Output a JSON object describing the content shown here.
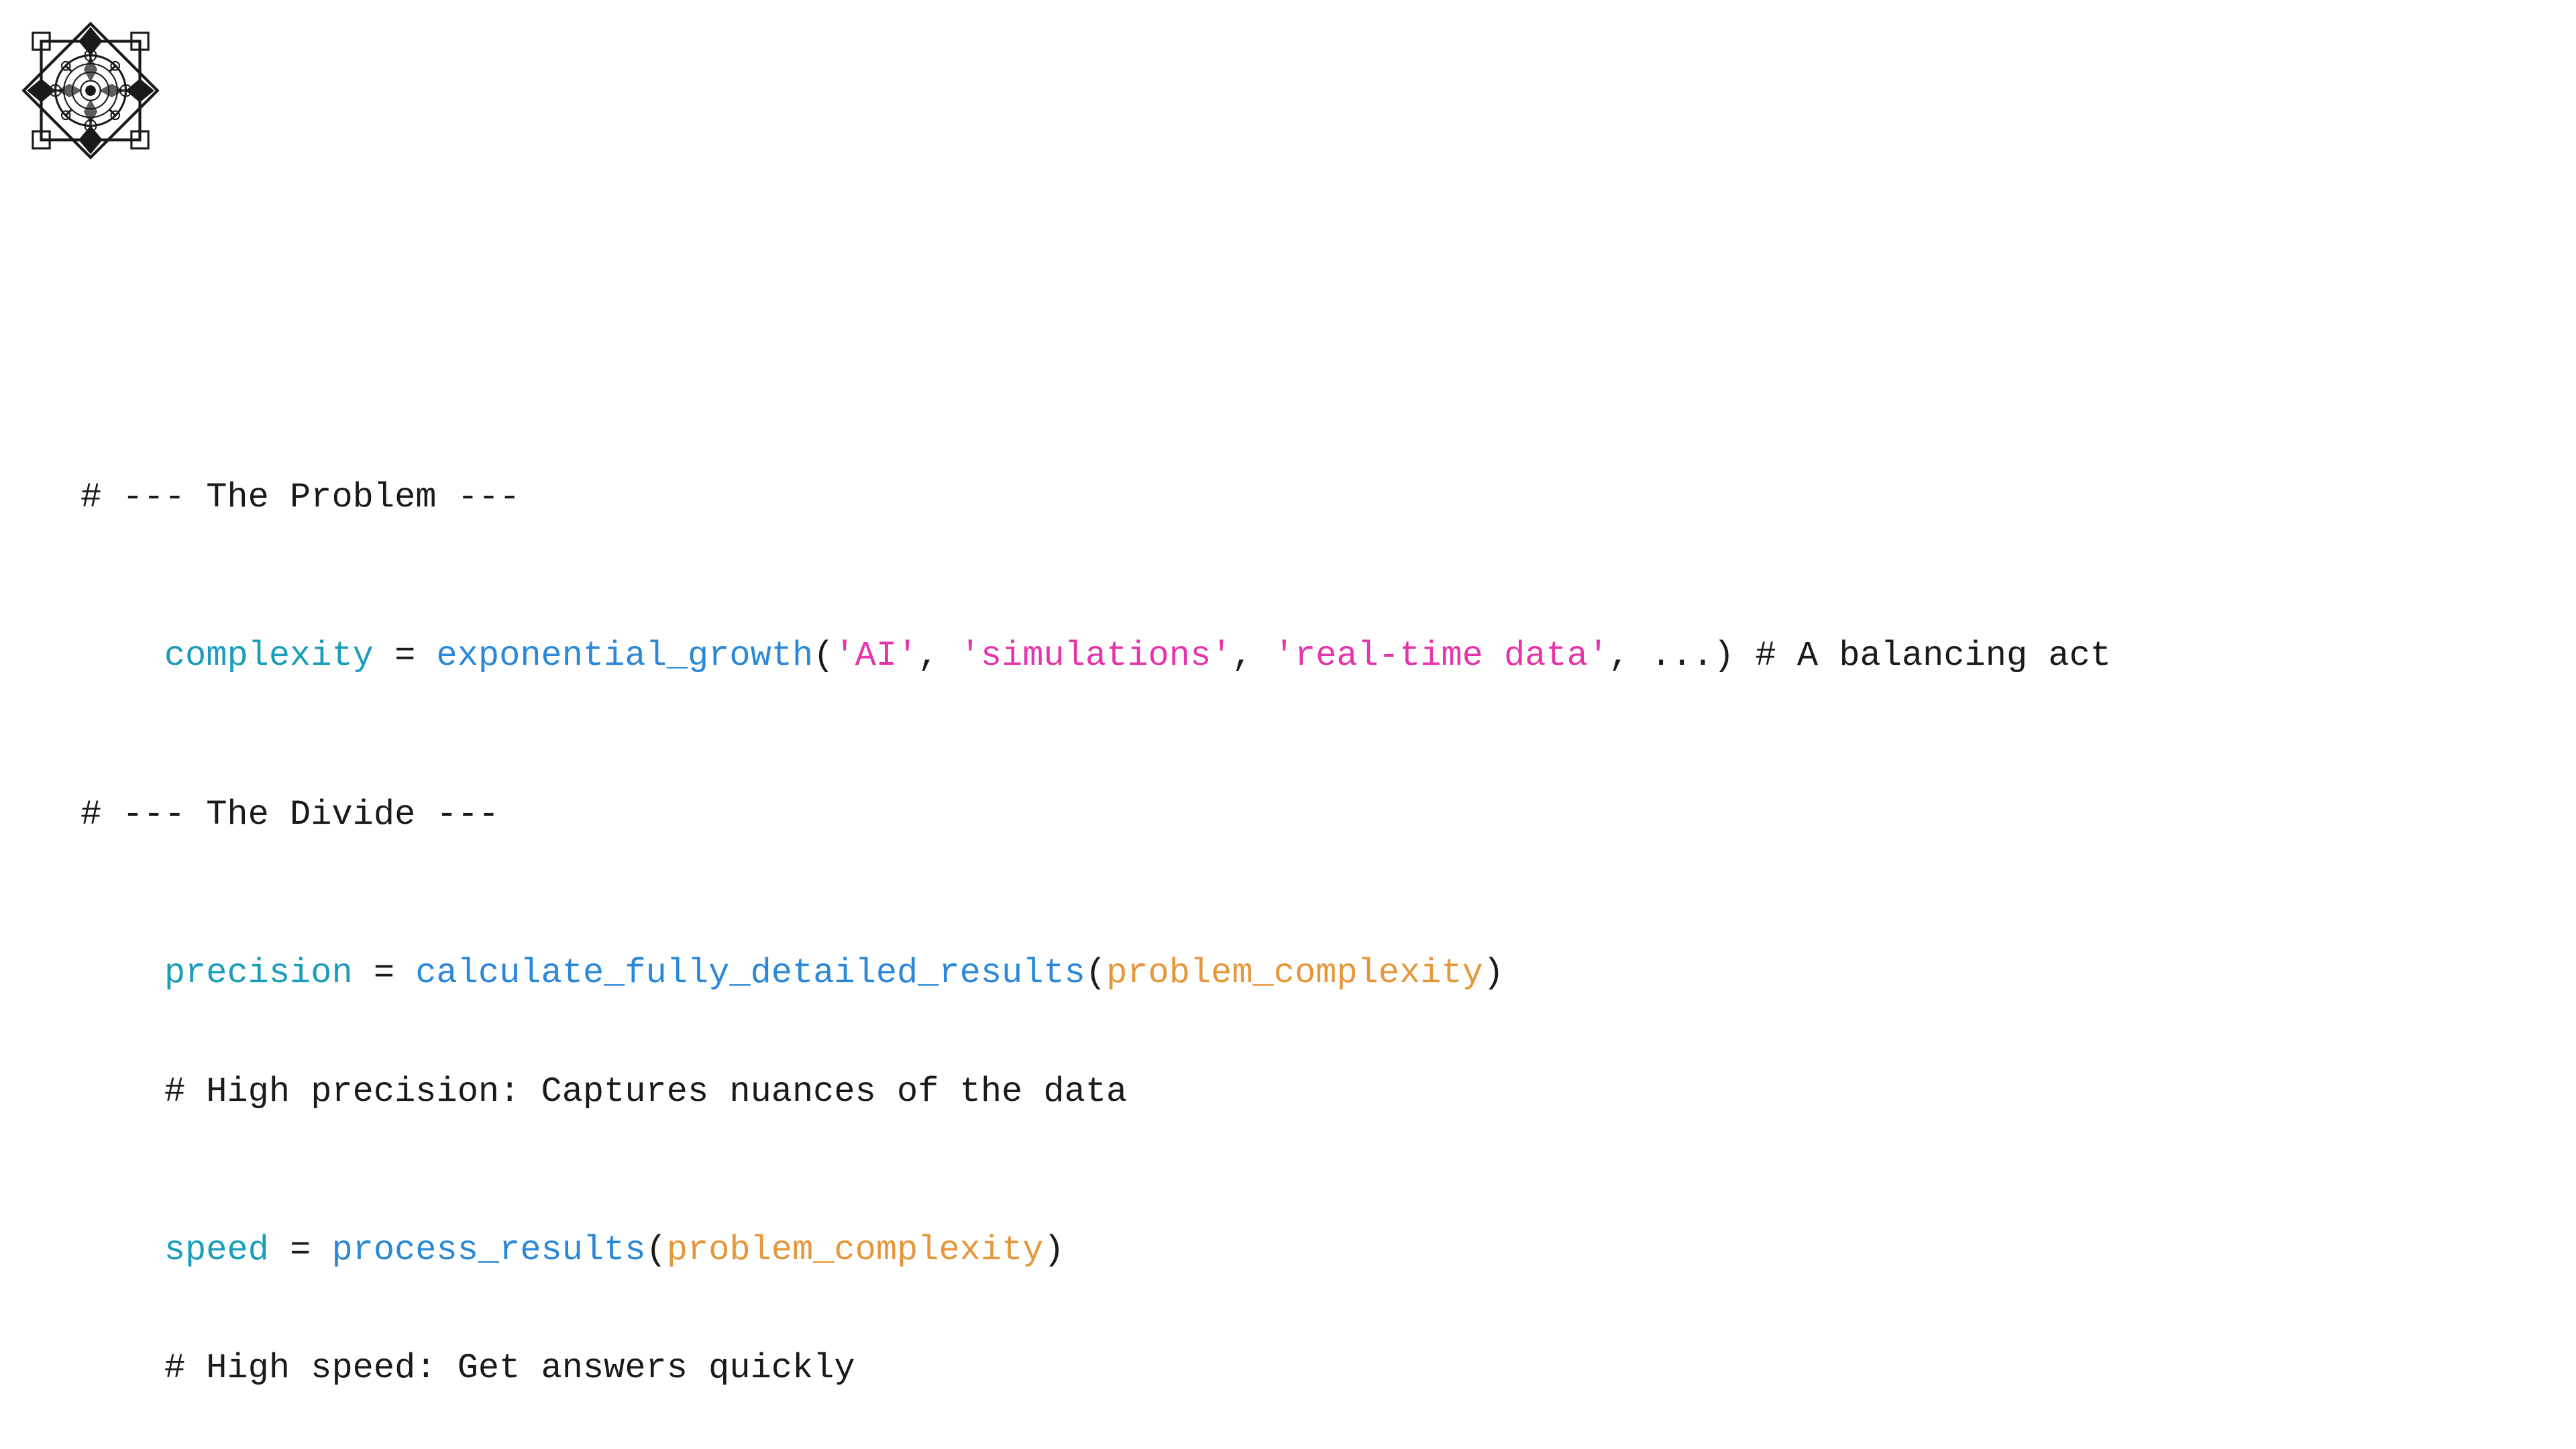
{
  "logo": {
    "alt": "Decorative mandala logo"
  },
  "code": {
    "section1_comment": "# --- The Problem ---",
    "line1_var": "complexity",
    "line1_op": " = ",
    "line1_func": "exponential_growth",
    "line1_args_open": "(",
    "line1_arg1": "'AI'",
    "line1_sep1": ", ",
    "line1_arg2": "'simulations'",
    "line1_sep2": ", ",
    "line1_arg3": "'real-time data'",
    "line1_sep3": ", ...)",
    "line1_comment": " # A balancing act",
    "section2_comment": "# --- The Divide ---",
    "line2_var": "precision",
    "line2_op": " = ",
    "line2_func": "calculate_fully_detailed_results",
    "line2_args_open": "(",
    "line2_arg1": "problem_complexity",
    "line2_args_close": ")",
    "line2_comment": "    # High precision: Captures nuances of the data",
    "line3_var": "speed",
    "line3_op": " = ",
    "line3_func": "process_results",
    "line3_args_open": "(",
    "line3_arg1": "problem_complexity",
    "line3_args_close": ")",
    "line3_comment": "    # High speed: Get answers quickly"
  }
}
